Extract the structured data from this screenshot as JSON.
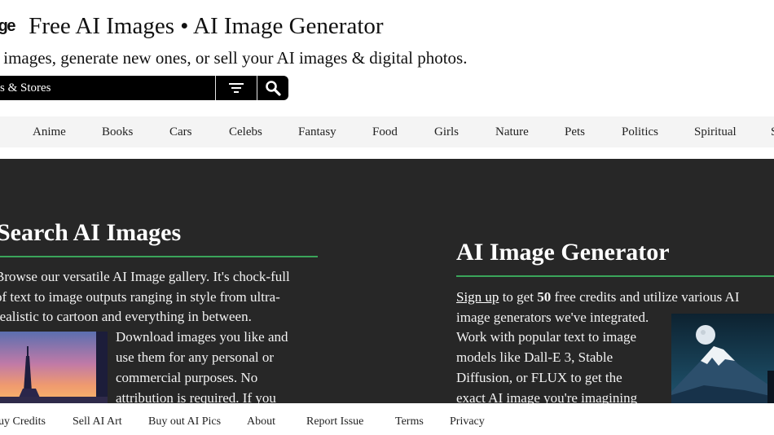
{
  "header": {
    "logo_fragment": "age",
    "title": "Free AI Images • AI Image Generator",
    "subtitle": "I images, generate new ones, or sell your AI images & digital photos."
  },
  "search": {
    "scope_label": "s & Stores",
    "filter_icon": "filter-icon",
    "search_icon": "search-icon"
  },
  "categories": [
    "Anime",
    "Books",
    "Cars",
    "Celebs",
    "Fantasy",
    "Food",
    "Girls",
    "Nature",
    "Pets",
    "Politics",
    "Spiritual",
    "S"
  ],
  "hero": {
    "left": {
      "heading": "Search AI Images",
      "lines": [
        "Browse our versatile AI Image gallery. It's chock-full",
        "of text to image outputs ranging in style from ultra-",
        "realistic to cartoon and everything in between."
      ],
      "wrap_lines": [
        "Download images you like and",
        "use them for any personal or",
        "commercial purposes. No",
        "attribution is required. If you"
      ]
    },
    "right": {
      "heading": "AI Image Generator",
      "signup_link": "Sign up",
      "line1_mid": " to get ",
      "credits": "50",
      "line1_end": " free credits and utilize various AI",
      "lines": [
        "image generators we've integrated.",
        "Work with popular text to image",
        "models like Dall-E 3, Stable",
        "Diffusion, or FLUX to get the",
        "exact AI image you're imagining"
      ]
    },
    "accent_color": "#3aa55a",
    "background_color": "#272727"
  },
  "footer": {
    "links": [
      "uy Credits",
      "Sell AI Art",
      "Buy out AI Pics",
      "About",
      "Report Issue",
      "Terms",
      "Privacy"
    ]
  }
}
